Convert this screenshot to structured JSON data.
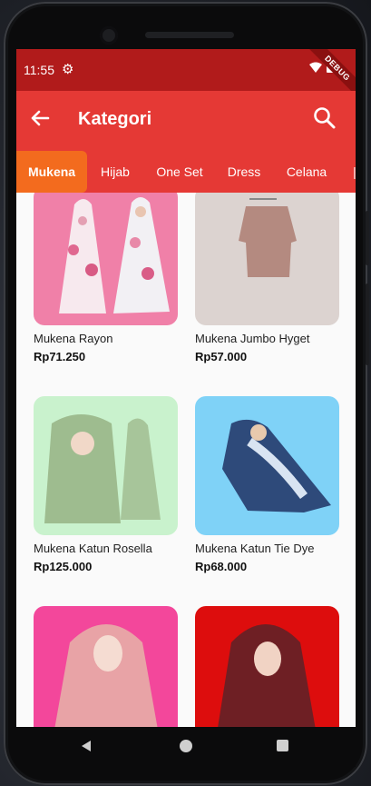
{
  "status": {
    "time": "11:55",
    "debug_label": "DEBUG"
  },
  "appbar": {
    "title": "Kategori"
  },
  "tabs": [
    {
      "label": "Mukena",
      "active": true
    },
    {
      "label": "Hijab",
      "active": false
    },
    {
      "label": "One Set",
      "active": false
    },
    {
      "label": "Dress",
      "active": false
    },
    {
      "label": "Celana",
      "active": false
    }
  ],
  "products": [
    {
      "name": "Mukena Rayon",
      "price": "Rp71.250",
      "bg": "#f080a8"
    },
    {
      "name": "Mukena Jumbo Hyget",
      "price": "Rp57.000",
      "bg": "#dcd3d0"
    },
    {
      "name": "Mukena Katun Rosella",
      "price": "Rp125.000",
      "bg": "#c9f2cd"
    },
    {
      "name": "Mukena Katun Tie Dye",
      "price": "Rp68.000",
      "bg": "#7fd2f7"
    },
    {
      "name": "",
      "price": "",
      "bg": "#f3479b"
    },
    {
      "name": "",
      "price": "",
      "bg": "#dd0d0d"
    }
  ],
  "colors": {
    "statusbar": "#b11b1b",
    "appbar": "#e53935",
    "tab_active": "#f36b1e"
  }
}
